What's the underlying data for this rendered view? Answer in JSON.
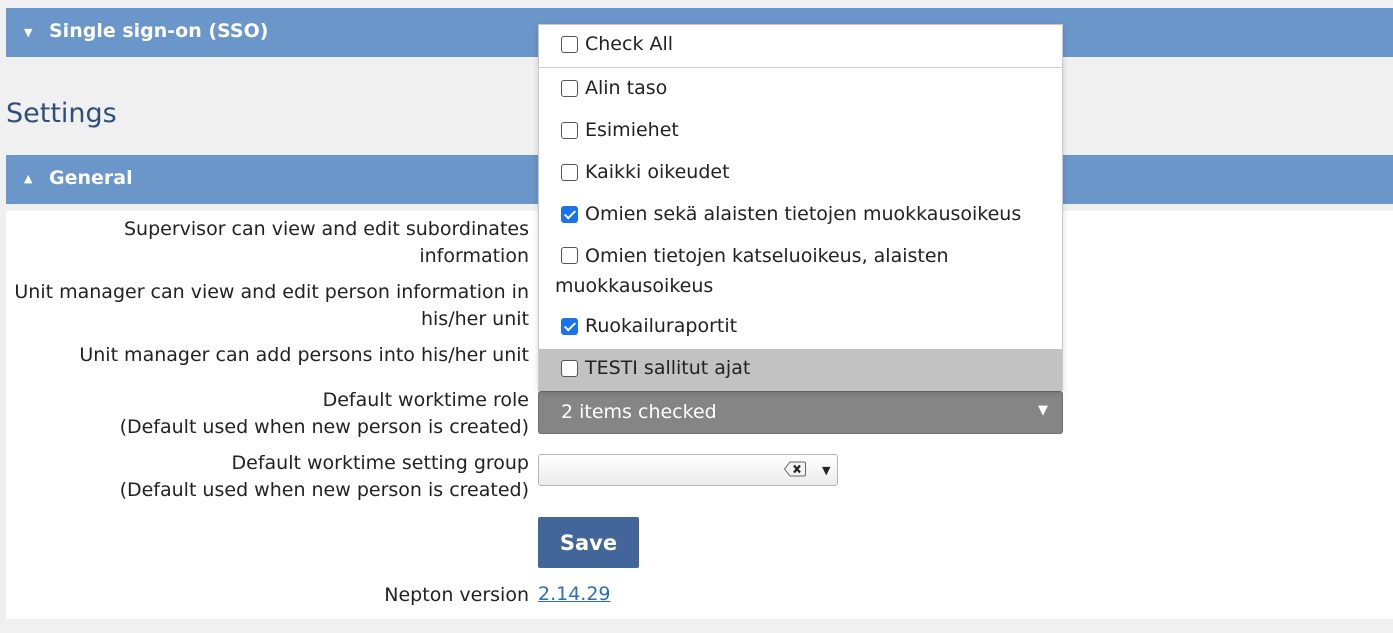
{
  "sso_section": {
    "title": "Single sign-on (SSO)",
    "expanded": false
  },
  "settings": {
    "heading": "Settings"
  },
  "general_section": {
    "title": "General",
    "expanded": true
  },
  "labels": {
    "supervisor_line1": "Supervisor can view and edit subordinates",
    "supervisor_line2": "information",
    "unit_manager_edit_line1": "Unit manager can view and edit person information in",
    "unit_manager_edit_line2": "his/her unit",
    "unit_manager_add": "Unit manager can add persons into his/her unit",
    "role_line1": "Default worktime role",
    "role_line2": "(Default used when new person is created)",
    "group_line1": "Default worktime setting group",
    "group_line2": "(Default used when new person is created)",
    "version_label": "Nepton version"
  },
  "role_select": {
    "value": "2 items checked",
    "check_all_label": "Check All",
    "options": [
      {
        "label": "Alin taso",
        "checked": false
      },
      {
        "label": "Esimiehet",
        "checked": false
      },
      {
        "label": "Kaikki oikeudet",
        "checked": false
      },
      {
        "label": "Omien sekä alaisten tietojen muokkausoikeus",
        "checked": true
      },
      {
        "label": "Omien tietojen katseluoikeus, alaisten muokkausoikeus",
        "checked": false
      },
      {
        "label": "Ruokailuraportit",
        "checked": true
      },
      {
        "label": "TESTI sallitut ajat",
        "checked": false
      }
    ]
  },
  "group_select": {
    "value": ""
  },
  "save_button": {
    "label": "Save"
  },
  "version": {
    "value": "2.14.29"
  },
  "colors": {
    "section_bar": "#6b96c9",
    "heading": "#2f4f7b",
    "save_button": "#43669a",
    "link": "#2a6ebb",
    "checkbox_checked": "#1a73e8",
    "select_bg": "#858585"
  }
}
